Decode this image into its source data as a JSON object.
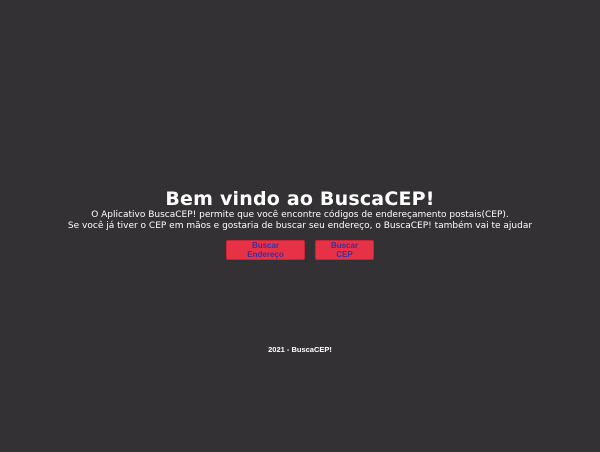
{
  "hero": {
    "title": "Bem vindo ao BuscaCEP!",
    "description_line1": "O Aplicativo BuscaCEP! permite que você encontre códigos de endereçamento postais(CEP).",
    "description_line2": "Se você já tiver o CEP em mãos e gostaria de buscar seu endereço, o BuscaCEP! também vai te ajudar"
  },
  "actions": {
    "search_address_label": "Buscar Endereço",
    "search_cep_label": "Buscar CEP"
  },
  "footer": {
    "text": "2021 - BuscaCEP!"
  },
  "colors": {
    "background": "#333133",
    "button_bg": "#e73147",
    "button_text": "#3d2f9b",
    "text": "#ffffff"
  }
}
